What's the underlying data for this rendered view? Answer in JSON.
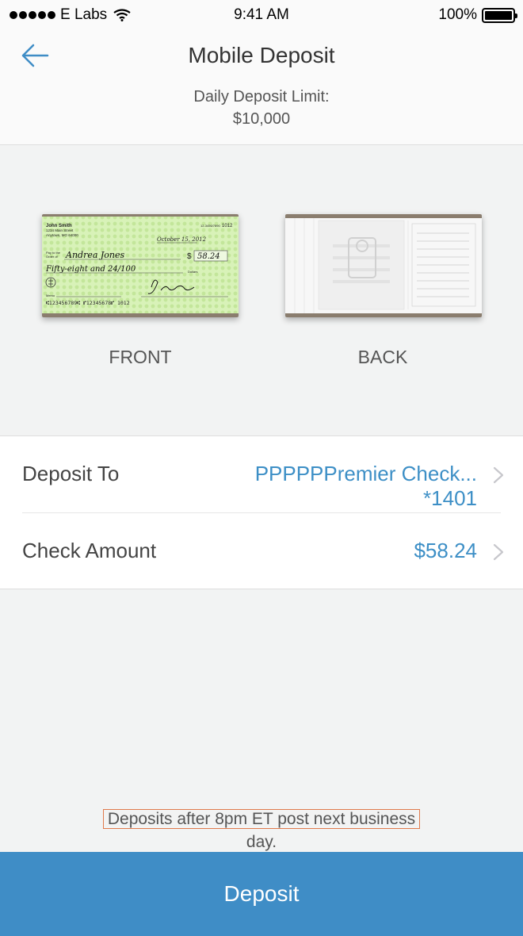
{
  "status_bar": {
    "carrier": "E Labs",
    "time": "9:41 AM",
    "battery": "100%"
  },
  "header": {
    "back_icon": "arrow-left-icon",
    "title": "Mobile Deposit",
    "limit_label": "Daily Deposit Limit:",
    "limit_value": "$10,000"
  },
  "checks": {
    "front_label": "FRONT",
    "back_label": "BACK",
    "front_check": {
      "name": "John Smith",
      "address_1": "1234 Main Street",
      "address_2": "Anytown, MO 64000",
      "number": "1012",
      "routing_top": "12-3456/7890",
      "date": "October 15, 2012",
      "payee": "Andrea Jones",
      "amount": "58.24",
      "amount_words": "Fifty-eight and 24/100",
      "dollars_label": "Dollars",
      "memo_label": "Memo",
      "micr": "⑆123456789⑆ ⑈12345678⑈ 1012"
    }
  },
  "deposit_to": {
    "label": "Deposit To",
    "value": "PPPPPPremier Check...",
    "account": "*1401"
  },
  "check_amount": {
    "label": "Check Amount",
    "value": "$58.24"
  },
  "notice": {
    "highlighted": "Deposits after 8pm ET post next business",
    "rest": "day."
  },
  "deposit_button": "Deposit",
  "colors": {
    "accent": "#3f8dc6",
    "link": "#3d8fc6",
    "highlight_border": "#e07a4c"
  }
}
